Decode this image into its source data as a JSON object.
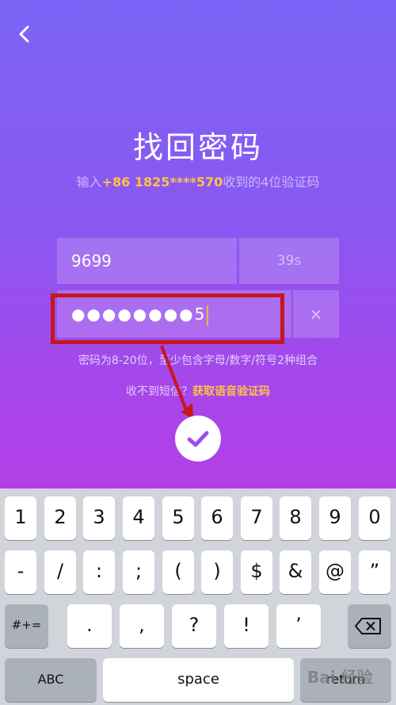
{
  "header": {
    "back_icon": "chevron-left-icon",
    "title": "找回密码"
  },
  "subtitle": {
    "prefix": "输入",
    "phone": "+86 1825****570",
    "suffix": "收到的4位验证码"
  },
  "form": {
    "code_value": "9699",
    "countdown": "39s",
    "password_masked": "●●●●●●●●",
    "password_last_char": "5",
    "clear_icon": "×",
    "hint": "密码为8-20位，至少包含字母/数字/符号2种组合",
    "sms_prompt": "收不到短信？",
    "voice_link": "获取语音验证码"
  },
  "confirm_icon": "checkmark-icon",
  "colors": {
    "gradient_top": "#7b63f6",
    "gradient_bottom": "#b33fe6",
    "accent": "#ffc24a",
    "annotation_red": "#c8161d"
  },
  "keyboard": {
    "row1": [
      "1",
      "2",
      "3",
      "4",
      "5",
      "6",
      "7",
      "8",
      "9",
      "0"
    ],
    "row2": [
      "-",
      "/",
      ":",
      ";",
      "(",
      ")",
      "$",
      "&",
      "@",
      "”"
    ],
    "row3_mode": "#+=",
    "row3": [
      ".",
      ",",
      "?",
      "!",
      "’"
    ],
    "row3_delete_icon": "backspace-icon",
    "row4_mode": "ABC",
    "row4_space": "space",
    "row4_return": "return"
  },
  "watermark": "Bai 经验"
}
